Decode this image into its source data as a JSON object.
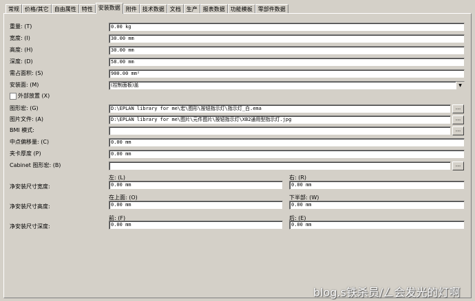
{
  "tabs": [
    "常规",
    "价格/其它",
    "自由属性",
    "特性",
    "安装数据",
    "附件",
    "技术数据",
    "文档",
    "生产",
    "报表数据",
    "功能模板",
    "零部件数据"
  ],
  "active_tab": "安装数据",
  "fields": {
    "weight": {
      "label": "重量: (T)",
      "value": "0.00 kg"
    },
    "width": {
      "label": "宽度: (I)",
      "value": "30.00 mm"
    },
    "height": {
      "label": "高度: (H)",
      "value": "30.00 mm"
    },
    "depth": {
      "label": "深度: (D)",
      "value": "58.00 mm"
    },
    "area": {
      "label": "需占面积: (S)",
      "value": "900.00 mm²"
    },
    "mount_face": {
      "label": "安装面: (M)",
      "value": "(控制面板)盖"
    },
    "external_place": {
      "label": "外部放置 (X)"
    },
    "graphic_macro": {
      "label": "图形宏: (G)",
      "value": "D:\\EPLAN library for me\\宏\\图形\\按钮指示灯\\指示灯_白.ema"
    },
    "image_file": {
      "label": "图片文件: (A)",
      "value": "D:\\EPLAN library for me\\图片\\元件图片\\按钮指示灯\\XB2通用型指示灯.jpg"
    },
    "bmi_mode": {
      "label": "BMI 模式:",
      "value": ""
    },
    "center_offset": {
      "label": "中点偏移量: (C)",
      "value": "0.00 mm"
    },
    "clip_thickness": {
      "label": "夹卡厚度 (P)",
      "value": "0.00 mm"
    },
    "cabinet_macro": {
      "label": "Cabinet 图形宏: (B)",
      "value": ""
    }
  },
  "net": {
    "width": {
      "label": "净安装尺寸宽度:",
      "left_label": "左: (L)",
      "left_value": "0.00 mm",
      "right_label": "右: (R)",
      "right_value": "0.00 mm"
    },
    "height": {
      "label": "净安装尺寸高度:",
      "left_label": "在上面: (O)",
      "left_value": "0.00 mm",
      "right_label": "下半部: (W)",
      "right_value": "0.00 mm"
    },
    "depth": {
      "label": "净安装尺寸深度:",
      "left_label": "前: (F)",
      "left_value": "0.00 mm",
      "right_label": "后: (E)",
      "right_value": "0.00 mm"
    }
  },
  "browse_label": "...",
  "dropdown_arrow": "▼",
  "watermark": "blog.s铁杀员/ㄥ会发光的灯啊"
}
